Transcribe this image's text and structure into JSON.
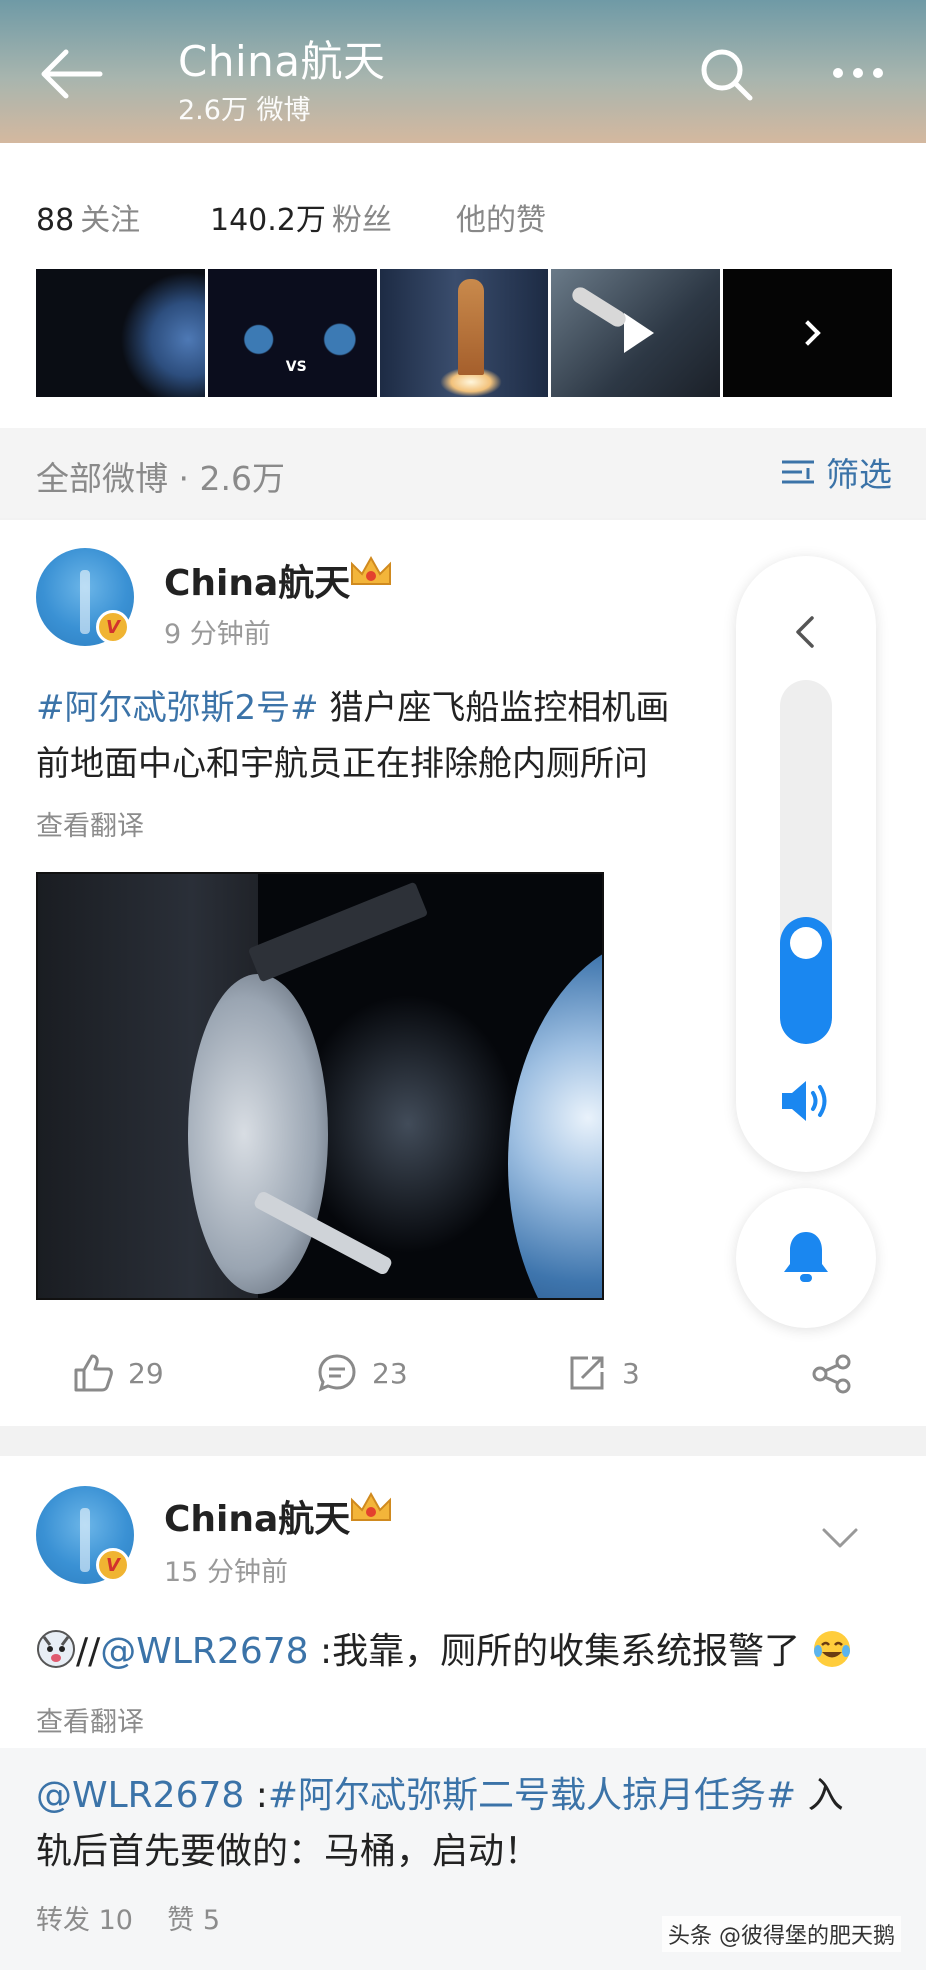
{
  "header": {
    "title": "China航天",
    "subtitle": "2.6万 微博",
    "back_icon": "arrow-left-icon",
    "search_icon": "search-icon",
    "more_icon": "more-icon"
  },
  "profile": {
    "following_count": "88",
    "following_label": "关注",
    "followers_count": "140.2万",
    "followers_label": "粉丝",
    "likes_label": "他的赞",
    "thumbnails": [
      {
        "icon": "thumbnail-image"
      },
      {
        "icon": "thumbnail-image",
        "text": "VS"
      },
      {
        "icon": "thumbnail-image"
      },
      {
        "icon": "play-icon"
      },
      {
        "icon": "chevron-right-icon"
      }
    ]
  },
  "feed_filter": {
    "label": "全部微博 · 2.6万",
    "button_label": "筛选",
    "button_icon": "filter-icon"
  },
  "posts": [
    {
      "author": "China航天",
      "time": "9 分钟前",
      "topic": "#阿尔忒弥斯2号#",
      "text_line1": " 猎户座飞船监控相机画",
      "text_line2": "前地面中心和宇航员正在排除舱内厕所问",
      "translate": "查看翻译",
      "likes": "29",
      "comments": "23",
      "reposts": "3"
    },
    {
      "author": "China航天",
      "time": "15 分钟前",
      "prefix": "//",
      "mention": "@WLR2678",
      "text": " :我靠，厕所的收集系统报警了",
      "translate": "查看翻译",
      "repost": {
        "mention": "@WLR2678",
        "sep": " :",
        "topic": "#阿尔忒弥斯二号载人掠月任务#",
        "text_a": " 入",
        "text_b": "轨后首先要做的：马桶，启动！",
        "meta": "转发 10    赞 5"
      }
    }
  ],
  "volume_overlay": {
    "level": 0.35,
    "accent_color": "#1a87f0"
  },
  "watermark": "头条 @彼得堡的肥天鹅",
  "colors": {
    "link": "#3b73a8",
    "muted": "#8a8a8a",
    "accent": "#1a87f0"
  }
}
